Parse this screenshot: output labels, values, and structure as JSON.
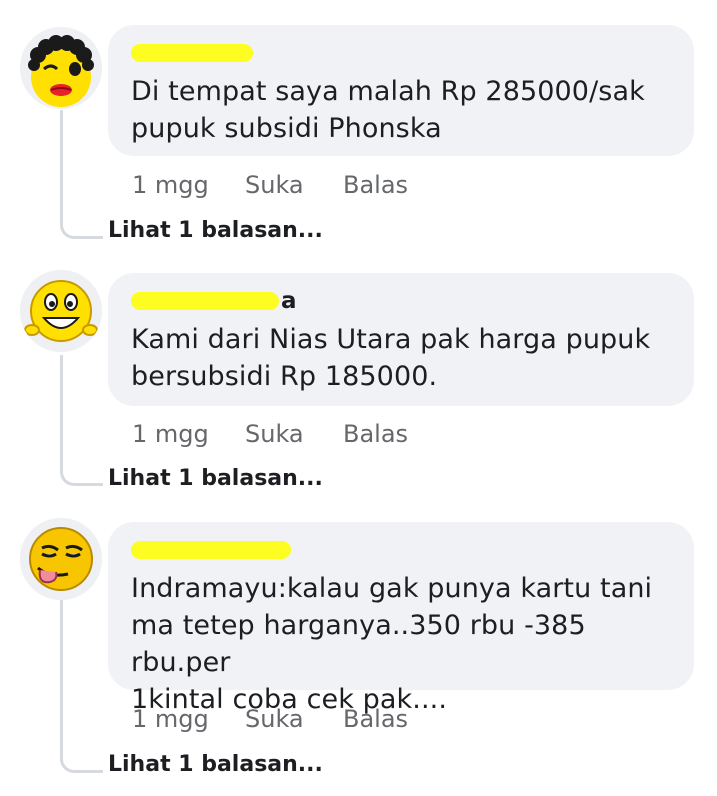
{
  "comments": [
    {
      "author_visible_tail": "",
      "text_lines": [
        "Di tempat saya malah Rp 285000/sak",
        "pupuk subsidi Phonska"
      ],
      "time": "1 mgg",
      "like_label": "Suka",
      "reply_label": "Balas",
      "view_replies": "Lihat 1 balasan...",
      "avatar_icon": "curly-hair-winking-emoji-icon"
    },
    {
      "author_visible_tail": "a",
      "text_lines": [
        "Kami dari Nias Utara pak harga pupuk",
        "bersubsidi  Rp 185000."
      ],
      "time": "1 mgg",
      "like_label": "Suka",
      "reply_label": "Balas",
      "view_replies": "Lihat 1 balasan...",
      "avatar_icon": "grinning-emoji-icon"
    },
    {
      "author_visible_tail": "",
      "text_lines": [
        "Indramayu:kalau gak punya kartu tani",
        "ma tetep harganya..350 rbu -385 rbu.per",
        "1kintal coba cek pak...."
      ],
      "time": "1 mgg",
      "like_label": "Suka",
      "reply_label": "Balas",
      "view_replies": "Lihat 1 balasan...",
      "avatar_icon": "tongue-out-emoji-icon"
    }
  ],
  "colors": {
    "bubble_bg": "#f0f2f5",
    "text": "#1c1e21",
    "meta": "#65676b",
    "thread_line": "#d6d9de",
    "redaction": "#fdfd22",
    "emoji_yellow": "#f9d71c"
  }
}
